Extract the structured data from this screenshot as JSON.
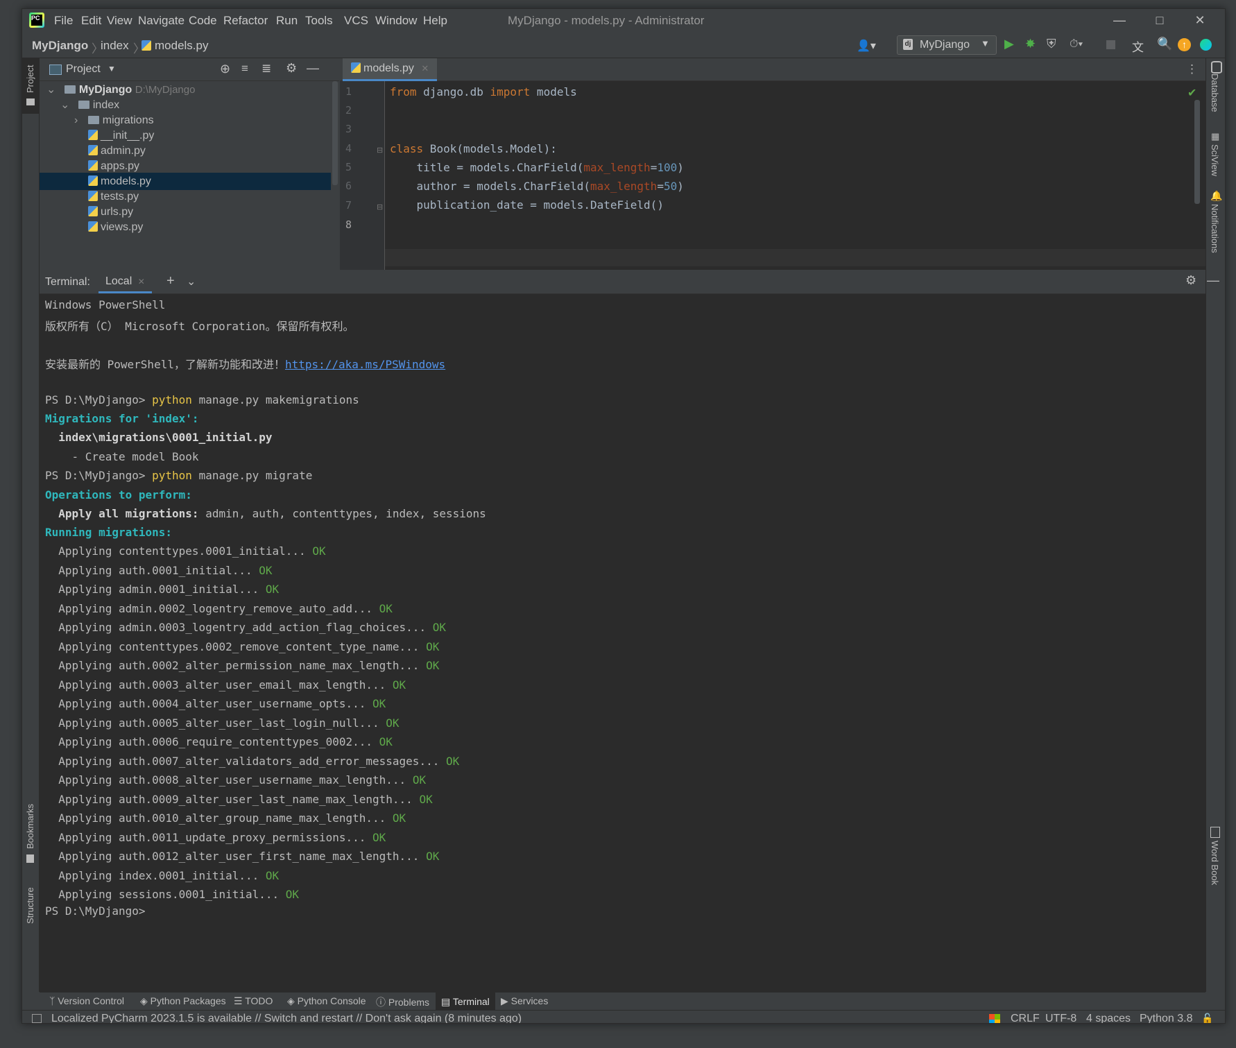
{
  "menu": [
    "File",
    "Edit",
    "View",
    "Navigate",
    "Code",
    "Refactor",
    "Run",
    "Tools",
    "VCS",
    "Window",
    "Help"
  ],
  "window_title": "MyDjango - models.py - Administrator",
  "breadcrumb": {
    "project": "MyDjango",
    "folder": "index",
    "file": "models.py"
  },
  "run_config": "MyDjango",
  "project_panel": {
    "title": "Project",
    "root_name": "MyDjango",
    "root_path": "D:\\MyDjango",
    "items": [
      "index",
      "migrations",
      "__init__.py",
      "admin.py",
      "apps.py",
      "models.py",
      "tests.py",
      "urls.py",
      "views.py"
    ]
  },
  "editor": {
    "tab": "models.py",
    "line_numbers": [
      "1",
      "2",
      "3",
      "4",
      "5",
      "6",
      "7",
      "8"
    ],
    "code": {
      "l1_kw1": "from",
      "l1_mid": " django.db ",
      "l1_kw2": "import",
      "l1_end": " models",
      "l4_kw": "class",
      "l4_rest": " Book(models.Model):",
      "l5_a": "    title = models.CharField(",
      "l5_p": "max_length",
      "l5_eq": "=",
      "l5_n": "100",
      "l5_c": ")",
      "l6_a": "    author = models.CharField(",
      "l6_p": "max_length",
      "l6_eq": "=",
      "l6_n": "50",
      "l6_c": ")",
      "l7": "    publication_date = models.DateField()"
    }
  },
  "terminal": {
    "label": "Terminal:",
    "tab": "Local",
    "header1": "Windows PowerShell",
    "header2": "版权所有（C） Microsoft Corporation。保留所有权利。",
    "install_text": "安装最新的 PowerShell，了解新功能和改进！",
    "install_link": "https://aka.ms/PSWindows",
    "prompt": "PS D:\\MyDjango>",
    "cmd1_python": "python",
    "cmd1_rest": " manage.py makemigrations",
    "migrations_for": "Migrations for 'index':",
    "migration_file": "  index\\migrations\\0001_initial.py",
    "create_model": "    - Create model Book",
    "cmd2_rest": " manage.py migrate",
    "ops_to_perform": "Operations to perform:",
    "apply_all_label": "  Apply all migrations:",
    "apply_all_apps": " admin, auth, contenttypes, index, sessions",
    "running": "Running migrations:",
    "ok": "OK",
    "applying": [
      "  Applying contenttypes.0001_initial... ",
      "  Applying auth.0001_initial... ",
      "  Applying admin.0001_initial... ",
      "  Applying admin.0002_logentry_remove_auto_add... ",
      "  Applying admin.0003_logentry_add_action_flag_choices... ",
      "  Applying contenttypes.0002_remove_content_type_name... ",
      "  Applying auth.0002_alter_permission_name_max_length... ",
      "  Applying auth.0003_alter_user_email_max_length... ",
      "  Applying auth.0004_alter_user_username_opts... ",
      "  Applying auth.0005_alter_user_last_login_null... ",
      "  Applying auth.0006_require_contenttypes_0002... ",
      "  Applying auth.0007_alter_validators_add_error_messages... ",
      "  Applying auth.0008_alter_user_username_max_length... ",
      "  Applying auth.0009_alter_user_last_name_max_length... ",
      "  Applying auth.0010_alter_group_name_max_length... ",
      "  Applying auth.0011_update_proxy_permissions... ",
      "  Applying auth.0012_alter_user_first_name_max_length... ",
      "  Applying index.0001_initial... ",
      "  Applying sessions.0001_initial... "
    ]
  },
  "side_tools": {
    "left": [
      "Project",
      "Bookmarks",
      "Structure"
    ],
    "right": [
      "Database",
      "SciView",
      "Notifications",
      "Word Book"
    ]
  },
  "bottom_tools": [
    "Version Control",
    "Python Packages",
    "TODO",
    "Python Console",
    "Problems",
    "Terminal",
    "Services"
  ],
  "status": {
    "message": "Localized PyCharm 2023.1.5 is available // Switch and restart // Don't ask again (8 minutes ago)",
    "line_sep": "CRLF",
    "encoding": "UTF-8",
    "indent": "4 spaces",
    "interpreter": "Python 3.8"
  },
  "colors": {
    "accent": "#4a88c7",
    "ok": "#5fa84a",
    "cyan": "#2fb8bd",
    "keyword": "#cc7832"
  }
}
